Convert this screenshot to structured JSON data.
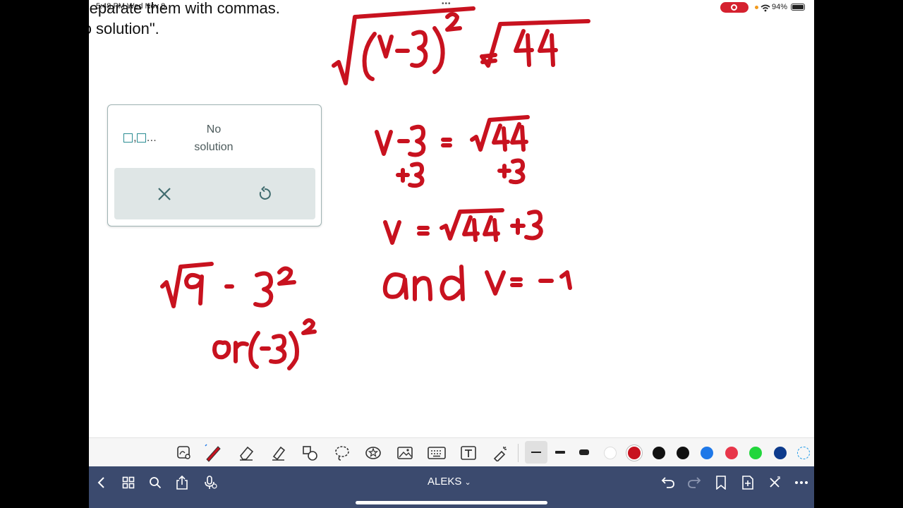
{
  "status": {
    "time": "5:48 PM  Wed Nov 8",
    "battery_pct": "94%"
  },
  "question": {
    "line1": "Separate them with commas.",
    "line2": "\"No solution\"."
  },
  "answer_widget": {
    "set_symbol": ",",
    "set_ellipsis": "...",
    "no_solution_line1": "No",
    "no_solution_line2": "solution"
  },
  "toolbar": {
    "tools": [
      "lasso-zoom-icon",
      "pen-icon",
      "eraser-icon",
      "highlighter-icon",
      "shapes-icon",
      "lasso-icon",
      "sticker-icon",
      "image-icon",
      "keyboard-icon",
      "text-icon",
      "laser-icon"
    ],
    "pen_sizes": [
      "thin",
      "medium",
      "thick"
    ],
    "colors": [
      "#ffffff",
      "#c8121f",
      "#111111",
      "#111111",
      "#1e78e8",
      "#e8364a",
      "#22d63c",
      "#0d3b8c"
    ]
  },
  "navbar": {
    "title": "ALEKS",
    "title_suffix": "⌄"
  }
}
